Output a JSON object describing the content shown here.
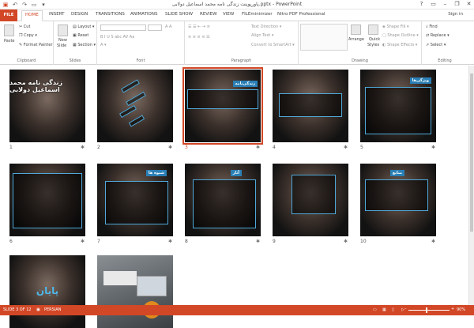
{
  "title": "پاورپوینت زندگی نامه محمد اسماعیل دولابی.pptx - PowerPoint",
  "window": {
    "min": "–",
    "max": "❐",
    "close": "✕",
    "help": "?"
  },
  "qat": [
    "save-icon",
    "undo-icon",
    "redo-icon",
    "start-icon",
    "customize-icon"
  ],
  "tabs": [
    "FILE",
    "HOME",
    "INSERT",
    "DESIGN",
    "TRANSITIONS",
    "ANIMATIONS",
    "SLIDE SHOW",
    "REVIEW",
    "VIEW",
    "FILEminimizer",
    "Nitro PDF Professional"
  ],
  "signin": "Sign in",
  "ribbon": {
    "clipboard": {
      "paste": "Paste",
      "cut": "Cut",
      "copy": "Copy",
      "format_painter": "Format Painter",
      "label": "Clipboard"
    },
    "slides": {
      "new_slide": "New",
      "new_slide2": "Slide",
      "layout": "Layout",
      "reset": "Reset",
      "section": "Section",
      "label": "Slides"
    },
    "font": {
      "label": "Font"
    },
    "paragraph": {
      "text_direction": "Text Direction",
      "align_text": "Align Text",
      "convert": "Convert to SmartArt",
      "label": "Paragraph"
    },
    "drawing": {
      "arrange": "Arrange",
      "quick": "Quick",
      "styles": "Styles",
      "fill": "Shape Fill",
      "outline": "Shape Outline",
      "effects": "Shape Effects",
      "label": "Drawing"
    },
    "editing": {
      "find": "Find",
      "replace": "Replace",
      "select": "Select",
      "label": "Editing"
    }
  },
  "slides": [
    {
      "num": "1",
      "title": "زندگی نامه محمد اسماعیل دولابی"
    },
    {
      "num": "2",
      "title": ""
    },
    {
      "num": "3",
      "title": "زندگی‌نامه"
    },
    {
      "num": "4",
      "title": ""
    },
    {
      "num": "5",
      "title": "ویژگی‌ها"
    },
    {
      "num": "6",
      "title": ""
    },
    {
      "num": "7",
      "title": "شیوه ها"
    },
    {
      "num": "8",
      "title": "آثار"
    },
    {
      "num": "9",
      "title": ""
    },
    {
      "num": "10",
      "title": "منابع"
    },
    {
      "num": "",
      "title": "پایان"
    },
    {
      "num": "",
      "title": ""
    }
  ],
  "status": {
    "slide": "SLIDE 3 OF 12",
    "lang": "PERSIAN",
    "zoom": "90%"
  },
  "colors": {
    "accent": "#d24726",
    "highlight": "#4fa8d8"
  }
}
